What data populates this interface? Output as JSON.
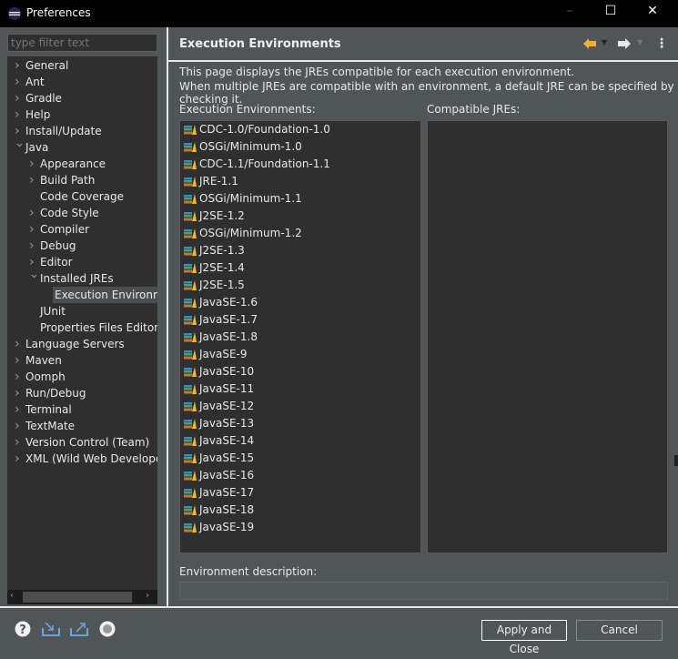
{
  "window": {
    "title": "Preferences",
    "minimize": "–",
    "maximize": "☐",
    "close": "✕"
  },
  "filter": {
    "placeholder": "type filter text"
  },
  "tree": [
    {
      "label": "General",
      "level": 0,
      "state": "collapsed"
    },
    {
      "label": "Ant",
      "level": 0,
      "state": "collapsed"
    },
    {
      "label": "Gradle",
      "level": 0,
      "state": "collapsed"
    },
    {
      "label": "Help",
      "level": 0,
      "state": "collapsed"
    },
    {
      "label": "Install/Update",
      "level": 0,
      "state": "collapsed"
    },
    {
      "label": "Java",
      "level": 0,
      "state": "expanded"
    },
    {
      "label": "Appearance",
      "level": 1,
      "state": "collapsed"
    },
    {
      "label": "Build Path",
      "level": 1,
      "state": "collapsed"
    },
    {
      "label": "Code Coverage",
      "level": 1,
      "state": "leaf"
    },
    {
      "label": "Code Style",
      "level": 1,
      "state": "collapsed"
    },
    {
      "label": "Compiler",
      "level": 1,
      "state": "collapsed"
    },
    {
      "label": "Debug",
      "level": 1,
      "state": "collapsed"
    },
    {
      "label": "Editor",
      "level": 1,
      "state": "collapsed"
    },
    {
      "label": "Installed JREs",
      "level": 1,
      "state": "expanded"
    },
    {
      "label": "Execution Environme",
      "level": 2,
      "state": "leaf",
      "selected": true
    },
    {
      "label": "JUnit",
      "level": 1,
      "state": "leaf"
    },
    {
      "label": "Properties Files Editor",
      "level": 1,
      "state": "leaf"
    },
    {
      "label": "Language Servers",
      "level": 0,
      "state": "collapsed"
    },
    {
      "label": "Maven",
      "level": 0,
      "state": "collapsed"
    },
    {
      "label": "Oomph",
      "level": 0,
      "state": "collapsed"
    },
    {
      "label": "Run/Debug",
      "level": 0,
      "state": "collapsed"
    },
    {
      "label": "Terminal",
      "level": 0,
      "state": "collapsed"
    },
    {
      "label": "TextMate",
      "level": 0,
      "state": "collapsed"
    },
    {
      "label": "Version Control (Team)",
      "level": 0,
      "state": "collapsed"
    },
    {
      "label": "XML (Wild Web Developer)",
      "level": 0,
      "state": "collapsed"
    }
  ],
  "page": {
    "title": "Execution Environments",
    "desc1": "This page displays the JREs compatible for each execution environment.",
    "desc2": "When multiple JREs are compatible with an environment, a default JRE can be specified by checking it.",
    "env_label": "Execution Environments:",
    "jre_label": "Compatible JREs:",
    "envdesc_label": "Environment description:",
    "environments": [
      "CDC-1.0/Foundation-1.0",
      "OSGi/Minimum-1.0",
      "CDC-1.1/Foundation-1.1",
      "JRE-1.1",
      "OSGi/Minimum-1.1",
      "J2SE-1.2",
      "OSGi/Minimum-1.2",
      "J2SE-1.3",
      "J2SE-1.4",
      "J2SE-1.5",
      "JavaSE-1.6",
      "JavaSE-1.7",
      "JavaSE-1.8",
      "JavaSE-9",
      "JavaSE-10",
      "JavaSE-11",
      "JavaSE-12",
      "JavaSE-13",
      "JavaSE-14",
      "JavaSE-15",
      "JavaSE-16",
      "JavaSE-17",
      "JavaSE-18",
      "JavaSE-19"
    ],
    "compatible_jres": []
  },
  "buttons": {
    "apply_close": "Apply and Close",
    "cancel": "Cancel"
  },
  "colors": {
    "back_arrow": "#f0b030",
    "forward_arrow": "#e8e8e8"
  }
}
